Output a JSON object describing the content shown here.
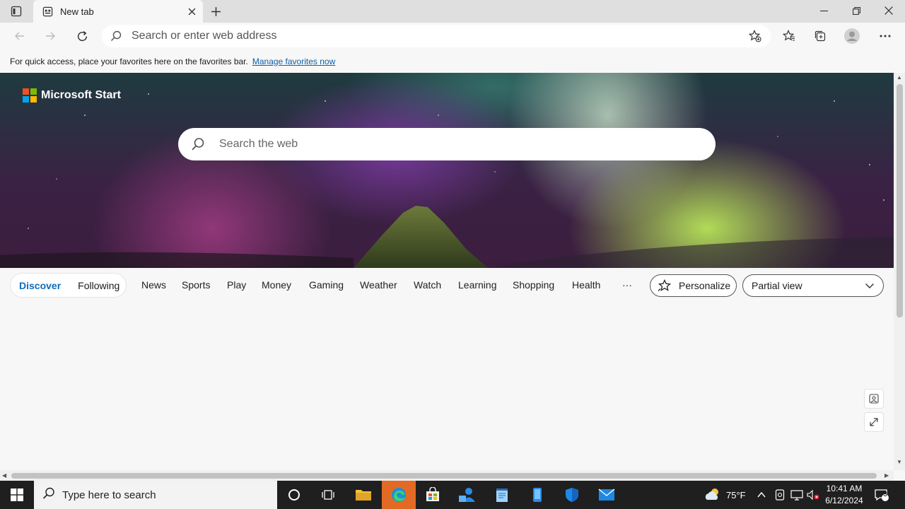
{
  "browser": {
    "tab": {
      "title": "New tab"
    },
    "address": {
      "placeholder": "Search or enter web address"
    },
    "favorites_bar": {
      "message": "For quick access, place your favorites here on the favorites bar.",
      "link": "Manage favorites now"
    },
    "icons": [
      "tab-actions-icon",
      "new-tab-icon",
      "close-icon",
      "minimize-icon",
      "restore-icon",
      "back-icon",
      "forward-icon",
      "refresh-icon",
      "search-icon",
      "add-favorite-icon",
      "favorites-icon",
      "collections-icon",
      "profile-icon",
      "more-icon"
    ]
  },
  "page": {
    "brand": "Microsoft Start",
    "search_placeholder": "Search the web",
    "nav": {
      "primary": [
        "Discover",
        "Following"
      ],
      "active": "Discover",
      "items": [
        "News",
        "Sports",
        "Play",
        "Money",
        "Gaming",
        "Weather",
        "Watch",
        "Learning",
        "Shopping",
        "Health"
      ],
      "more": "···",
      "personalize": "Personalize",
      "view_select": "Partial view"
    },
    "colors": {
      "accent": "#0f6cbd",
      "link": "#0f5ea8",
      "ms_logo": [
        "#f25022",
        "#7fba00",
        "#00a4ef",
        "#ffb900"
      ]
    }
  },
  "taskbar": {
    "search_placeholder": "Type here to search",
    "weather_temp": "75°F",
    "time": "10:41 AM",
    "date": "6/12/2024",
    "notification_count": "3",
    "active_app_color": "#e36a25"
  }
}
